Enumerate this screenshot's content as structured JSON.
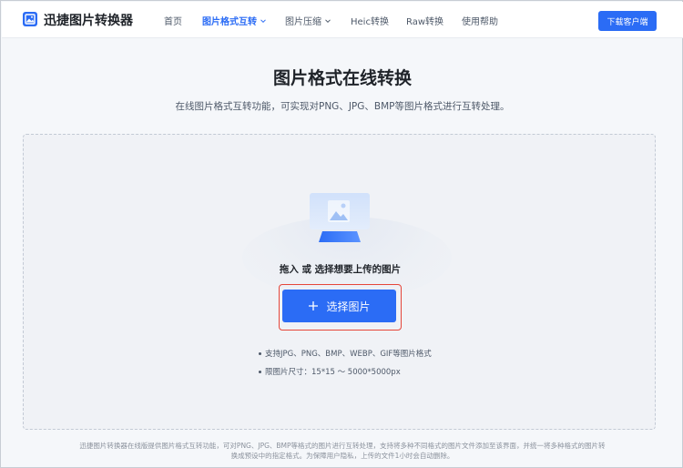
{
  "header": {
    "brand": "迅捷图片转换器",
    "nav": [
      {
        "label": "首页",
        "active": false,
        "dropdown": false
      },
      {
        "label": "图片格式互转",
        "active": true,
        "dropdown": true
      },
      {
        "label": "图片压缩",
        "active": false,
        "dropdown": true
      },
      {
        "label": "Heic转换",
        "active": false,
        "dropdown": false
      },
      {
        "label": "Raw转换",
        "active": false,
        "dropdown": false
      },
      {
        "label": "使用帮助",
        "active": false,
        "dropdown": false
      }
    ],
    "download_label": "下载客户端"
  },
  "main": {
    "title": "图片格式在线转换",
    "subtitle": "在线图片格式互转功能，可实现对PNG、JPG、BMP等图片格式进行互转处理。"
  },
  "upload": {
    "hint": "拖入 或 选择想要上传的图片",
    "button_label": "选择图片",
    "rules": [
      "支持JPG、PNG、BMP、WEBP、GIF等图片格式",
      "限图片尺寸：15*15 ～ 5000*5000px"
    ]
  },
  "footer": {
    "line1": "迅捷图片转换器在线版提供图片格式互转功能，可对PNG、JPG、BMP等格式的图片进行互转处理，支持将多种不同格式的图片文件添加至该界面，并统一将多种格式的图片转",
    "line2": "换成预设中的指定格式。为保障用户隐私，上传的文件1小时会自动删除。"
  },
  "colors": {
    "accent": "#2b6cf5",
    "highlight_border": "#e5463a",
    "text_primary": "#1f2329",
    "text_secondary": "#4e5969"
  },
  "icons": [
    "logo-icon",
    "chevron-down-icon",
    "image-upload-icon",
    "plus-icon"
  ]
}
